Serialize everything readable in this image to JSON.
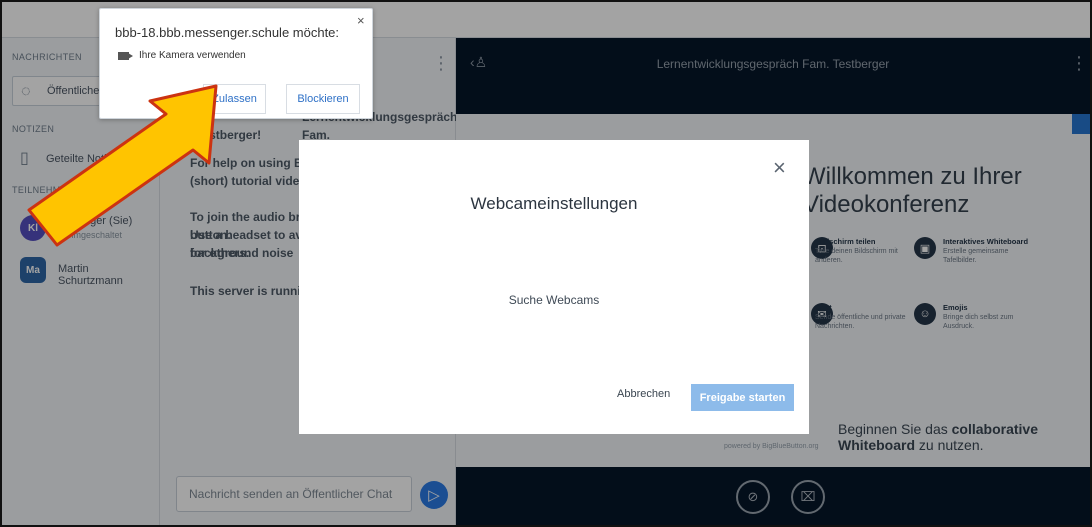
{
  "browser": {
    "permission": {
      "title": "bbb-18.bbb.messenger.schule möchte:",
      "request": "Ihre Kamera verwenden",
      "allow": "Zulassen",
      "block": "Blockieren",
      "close": "×"
    }
  },
  "sidebar": {
    "messages_title": "NACHRICHTEN",
    "public_chat": "Öffentlicher Chat",
    "notes_title": "NOTIZEN",
    "shared_notes": "Geteilte Notizen",
    "participants_title": "TEILNEHMER",
    "participants": [
      {
        "initials": "Kl",
        "name": "Testberger (Sie)",
        "status": "stummgeschaltet",
        "color": "#554fc1"
      },
      {
        "initials": "Ma",
        "name": "Martin Schurtzmann",
        "status": "",
        "color": "#2e67a6"
      }
    ]
  },
  "chat": {
    "message_lines": [
      "Lernentwicklungsgespräch Fam.",
      "Testberger!",
      "For help on using BigBlueButton see these",
      "(short) tutorial videos.",
      "To join the audio bridge click the phone button.",
      "Use a headset to avoid causing background noise",
      "for others.",
      "This server is running BigBlueButton."
    ],
    "input_placeholder": "Nachricht senden an Öffentlicher Chat",
    "send_icon": "▷"
  },
  "main": {
    "title": "Lernentwicklungsgespräch Fam. Testberger",
    "headline": "Willkommen zu Ihrer Videokonferenz",
    "features": [
      {
        "icon": "⊡",
        "title": "Bildschirm teilen",
        "desc": "Teile deinen Bildschirm mit anderen."
      },
      {
        "icon": "▣",
        "title": "Interaktives Whiteboard",
        "desc": "Erstelle gemeinsame Tafelbilder."
      },
      {
        "icon": "✉",
        "title": "Chat",
        "desc": "Sende öffentliche und private Nachrichten."
      },
      {
        "icon": "☺",
        "title": "Emojis",
        "desc": "Bringe dich selbst zum Ausdruck."
      }
    ],
    "bottom_prefix": "Beginnen Sie das ",
    "bottom_bold": "collaborative Whiteboard",
    "bottom_suffix": " zu nutzen.",
    "powered": "powered by BigBlueButton.org",
    "controls": [
      "⊘",
      "⌧"
    ]
  },
  "modal": {
    "title": "Webcameinstellungen",
    "searching": "Suche Webcams",
    "cancel": "Abbrechen",
    "start": "Freigabe starten",
    "close": "×"
  }
}
